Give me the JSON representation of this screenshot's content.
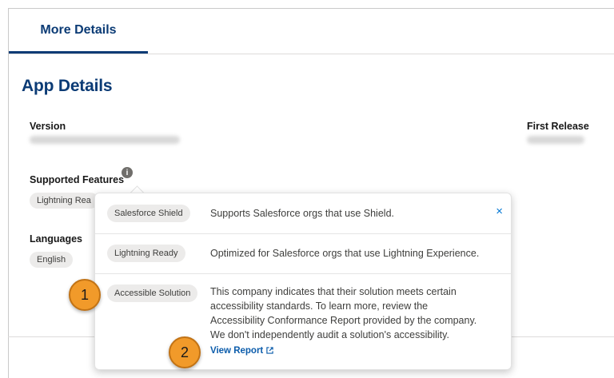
{
  "tabs": [
    {
      "label": "More Details",
      "active": true
    }
  ],
  "app_details": {
    "title": "App Details",
    "version": {
      "label": "Version"
    },
    "first_release": {
      "label": "First Release"
    },
    "supported_features": {
      "label": "Supported Features",
      "pills": [
        "Lightning Rea"
      ]
    },
    "languages": {
      "label": "Languages",
      "pills": [
        "English"
      ]
    }
  },
  "popover": {
    "rows": [
      {
        "pill": "Salesforce Shield",
        "description": "Supports Salesforce orgs that use Shield."
      },
      {
        "pill": "Lightning Ready",
        "description": "Optimized for Salesforce orgs that use Lightning Experience."
      },
      {
        "pill": "Accessible Solution",
        "description_lines": [
          "This company indicates that their solution meets certain",
          "accessibility standards. To learn more, review the",
          "Accessibility Conformance Report provided by the company.",
          "We don't independently audit a solution's accessibility."
        ],
        "link": "View Report"
      }
    ],
    "close_glyph": "×"
  },
  "callouts": [
    "1",
    "2"
  ],
  "colors": {
    "brand_navy": "#0b3b75",
    "link_blue": "#0b5cab",
    "callout_orange": "#f19a2a"
  },
  "icons": [
    "info-icon",
    "close-icon",
    "external-link-icon"
  ]
}
